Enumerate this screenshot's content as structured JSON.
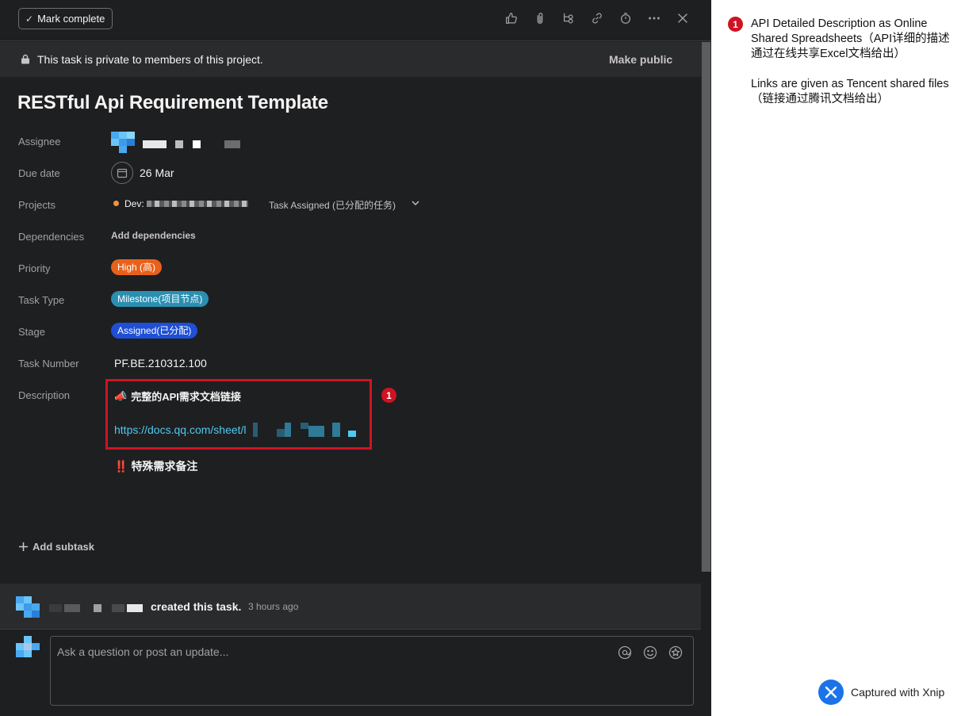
{
  "header": {
    "mark_complete_label": "Mark complete",
    "toolbar_icons": [
      "thumbs-up-icon",
      "paperclip-icon",
      "subtask-icon",
      "link-icon",
      "timer-icon",
      "more-icon",
      "close-icon"
    ]
  },
  "privacy": {
    "text": "This task is private to members of this project.",
    "action": "Make public"
  },
  "task": {
    "title": "RESTful Api Requirement Template",
    "fields": {
      "assignee_label": "Assignee",
      "due_date_label": "Due date",
      "due_date_value": "26 Mar",
      "projects_label": "Projects",
      "project_name": "Dev:",
      "project_status": "Task Assigned (已分配的任务)",
      "dependencies_label": "Dependencies",
      "dependencies_action": "Add dependencies",
      "priority_label": "Priority",
      "priority_value": "High (高)",
      "task_type_label": "Task Type",
      "task_type_value": "Milestone(项目节点)",
      "stage_label": "Stage",
      "stage_value": "Assigned(已分配)",
      "task_number_label": "Task Number",
      "task_number_value": "PF.BE.210312.100",
      "description_label": "Description"
    },
    "description": {
      "line1_emoji": "📣",
      "line1": "完整的API需求文档链接",
      "link": "https://docs.qq.com/sheet/l",
      "line3_prefix": "‼️",
      "line3": "特殊需求备注"
    },
    "add_subtask": "Add subtask"
  },
  "activity": {
    "text": "created this task.",
    "time": "3 hours ago"
  },
  "comment": {
    "placeholder": "Ask a question or post an update..."
  },
  "annotation": {
    "badge": "1",
    "note_1": "API Detailed Description as Online Shared Spreadsheets（API详细的描述通过在线共享Excel文档给出）",
    "note_2": "Links are given as Tencent shared files（链接通过腾讯文档给出）"
  },
  "watermark": {
    "text": "Captured with Xnip"
  },
  "colors": {
    "pane_bg": "#1e1f21",
    "priority_pill": "#e8611a",
    "task_type_pill": "#2b8fb1",
    "stage_pill": "#1f4fd6",
    "highlight_red": "#cf1322",
    "link_blue": "#4ec9f0"
  }
}
